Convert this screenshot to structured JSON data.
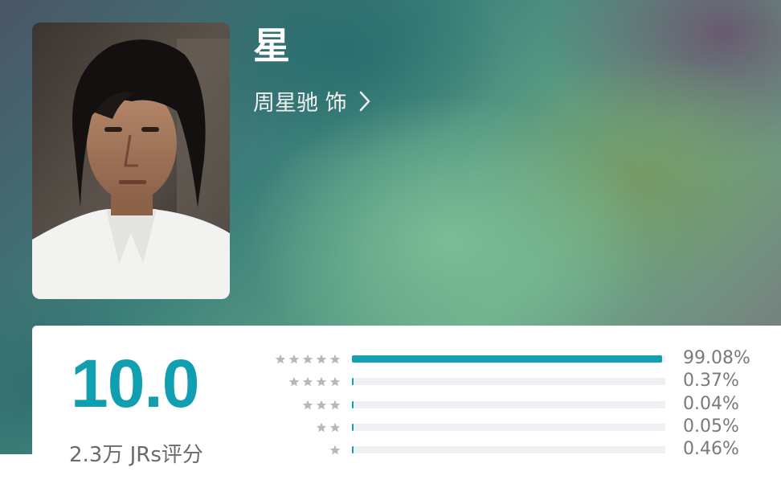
{
  "character": {
    "name": "星",
    "actor_label": "周星驰 饰",
    "chevron_icon": "chevron-right-icon"
  },
  "rating": {
    "score": "10.0",
    "raters_text": "2.3万 JRs评分",
    "accent_color": "#12a0b2",
    "distribution": [
      {
        "stars": 5,
        "percent_text": "99.08%",
        "fraction": 0.9908
      },
      {
        "stars": 4,
        "percent_text": "0.37%",
        "fraction": 0.0037
      },
      {
        "stars": 3,
        "percent_text": "0.04%",
        "fraction": 0.0004
      },
      {
        "stars": 2,
        "percent_text": "0.05%",
        "fraction": 0.0005
      },
      {
        "stars": 1,
        "percent_text": "0.46%",
        "fraction": 0.0046
      }
    ]
  }
}
